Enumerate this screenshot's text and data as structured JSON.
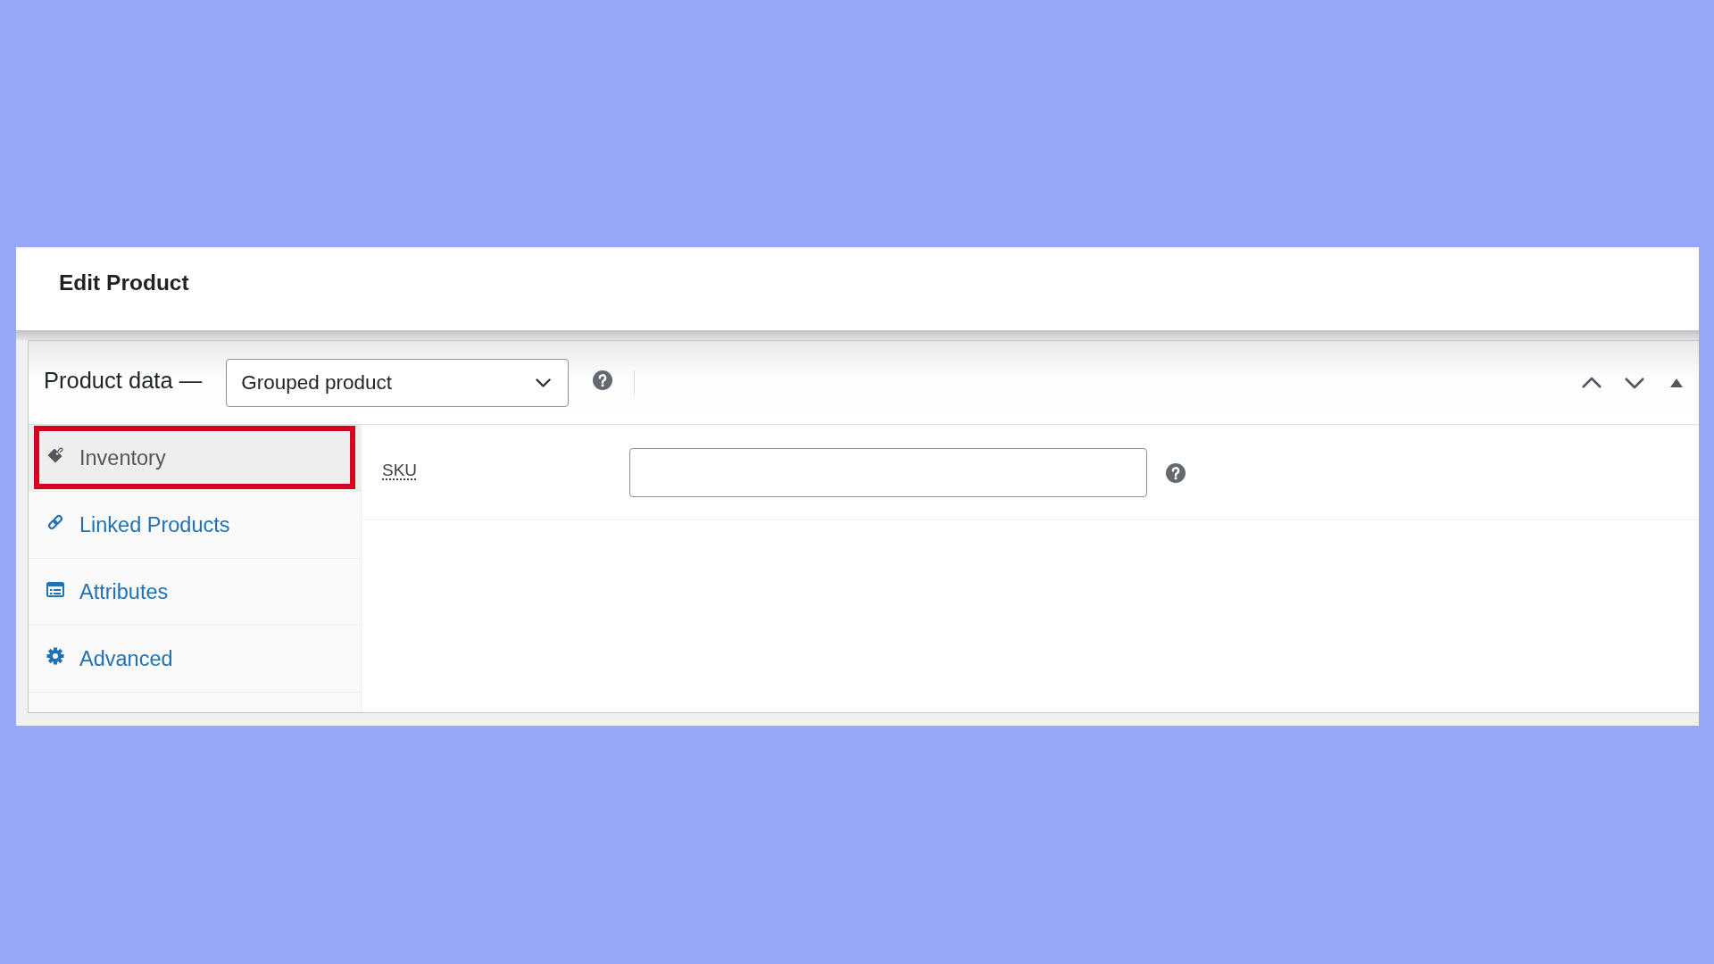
{
  "header": {
    "title": "Edit Product"
  },
  "product_data": {
    "title": "Product data —",
    "product_type": "Grouped product"
  },
  "tabs": [
    {
      "label": "Inventory",
      "selected": true,
      "highlighted": true
    },
    {
      "label": "Linked Products",
      "selected": false,
      "highlighted": false
    },
    {
      "label": "Attributes",
      "selected": false,
      "highlighted": false
    },
    {
      "label": "Advanced",
      "selected": false,
      "highlighted": false
    }
  ],
  "fields": [
    {
      "label": "SKU"
    }
  ]
}
